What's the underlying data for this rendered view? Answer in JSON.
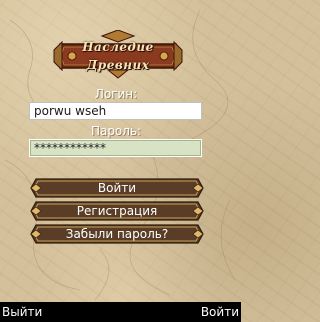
{
  "logo": {
    "line1": "Наследие",
    "line2": "Древних"
  },
  "login": {
    "label": "Логин:",
    "value": "porwu wseh"
  },
  "password": {
    "label": "Пароль:",
    "value": "************"
  },
  "menu": [
    {
      "label": "Войти"
    },
    {
      "label": "Регистрация"
    },
    {
      "label": "Забыли пароль?"
    }
  ],
  "softkeys": {
    "left": "Выйти",
    "right": "Войти"
  },
  "colors": {
    "background": "#d4c19b",
    "button_fill": "#5a3d26",
    "button_border": "#c99f57",
    "field_fill": "#d8e2c4",
    "softbar": "#000000"
  }
}
